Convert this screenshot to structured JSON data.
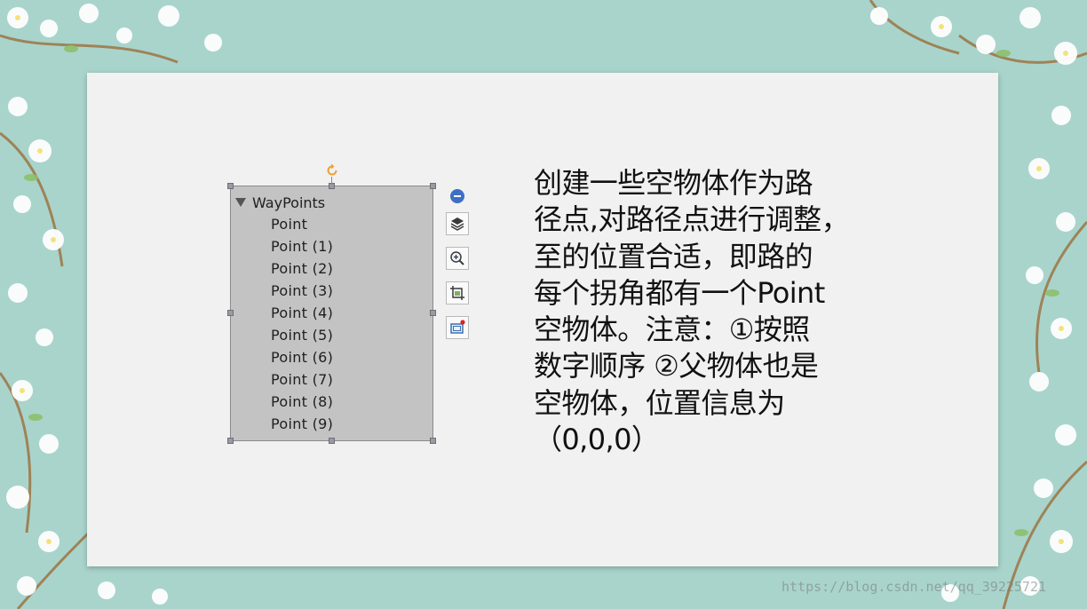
{
  "hierarchy": {
    "root_label": "WayPoints",
    "children": [
      "Point",
      "Point (1)",
      "Point (2)",
      "Point (3)",
      "Point (4)",
      "Point (5)",
      "Point (6)",
      "Point (7)",
      "Point (8)",
      "Point (9)"
    ]
  },
  "toolbar": {
    "items": [
      "minus-icon",
      "layers-icon",
      "zoom-in-icon",
      "crop-icon",
      "picture-frame-icon"
    ]
  },
  "description": {
    "lines": [
      "创建一些空物体作为路",
      "径点,对路径点进行调整，",
      "至的位置合适，即路的",
      "每个拐角都有一个Point",
      "空物体。注意：①按照",
      "数字顺序 ②父物体也是",
      "空物体，位置信息为",
      "（0,0,0）"
    ]
  },
  "watermark": "https://blog.csdn.net/qq_39225721",
  "colors": {
    "background": "#a9d4cc",
    "slide": "#f0f1f0",
    "panel": "#c3c3c3",
    "rotate_handle": "#f0a030",
    "toolbar_accent": "#3f6fc4"
  }
}
